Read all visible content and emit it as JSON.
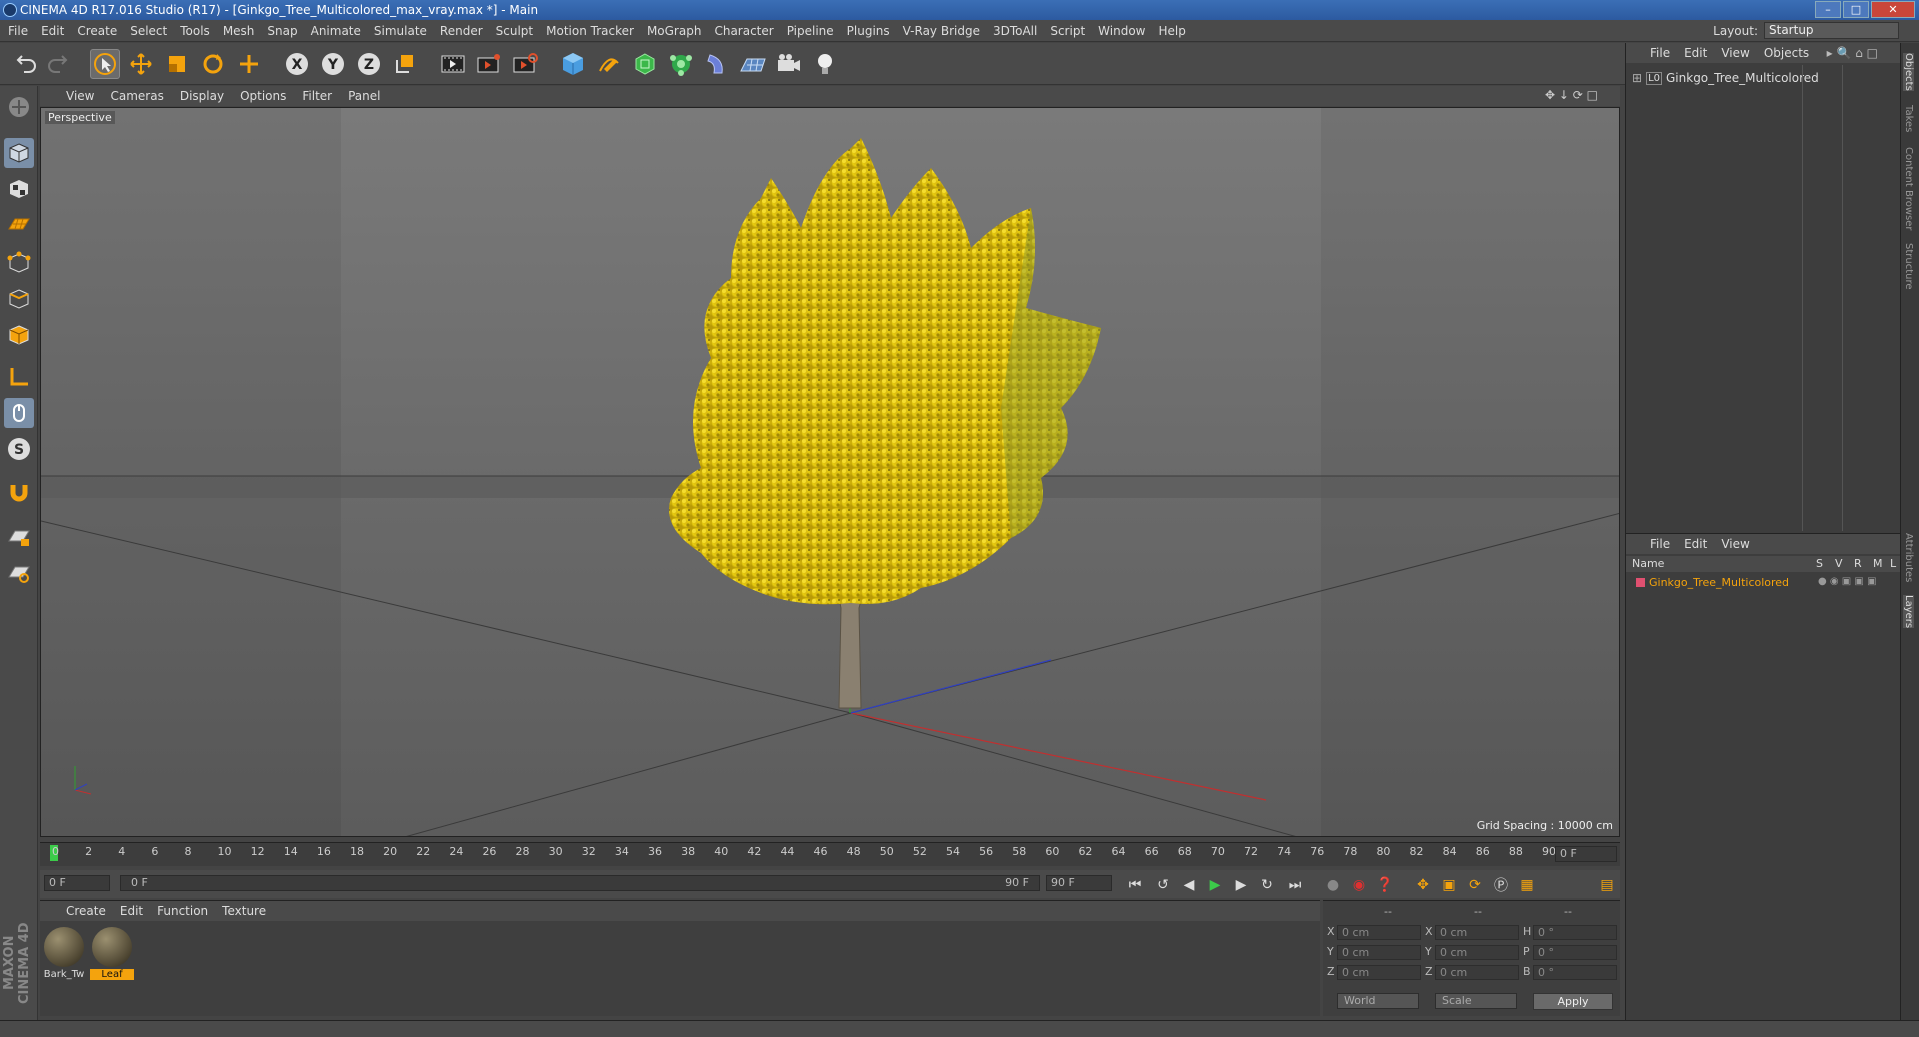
{
  "window": {
    "title": "CINEMA 4D R17.016 Studio (R17) - [Ginkgo_Tree_Multicolored_max_vray.max *] - Main"
  },
  "menubar": {
    "items": [
      "File",
      "Edit",
      "Create",
      "Select",
      "Tools",
      "Mesh",
      "Snap",
      "Animate",
      "Simulate",
      "Render",
      "Sculpt",
      "Motion Tracker",
      "MoGraph",
      "Character",
      "Pipeline",
      "Plugins",
      "V-Ray Bridge",
      "3DToAll",
      "Script",
      "Window",
      "Help"
    ]
  },
  "layout": {
    "label": "Layout:",
    "value": "Startup"
  },
  "viewport": {
    "menu": [
      "View",
      "Cameras",
      "Display",
      "Options",
      "Filter",
      "Panel"
    ],
    "camera_label": "Perspective",
    "grid_spacing": "Grid Spacing : 10000 cm"
  },
  "timeline": {
    "ticks": [
      "0",
      "2",
      "4",
      "6",
      "8",
      "10",
      "12",
      "14",
      "16",
      "18",
      "20",
      "22",
      "24",
      "26",
      "28",
      "30",
      "32",
      "34",
      "36",
      "38",
      "40",
      "42",
      "44",
      "46",
      "48",
      "50",
      "52",
      "54",
      "56",
      "58",
      "60",
      "62",
      "64",
      "66",
      "68",
      "70",
      "72",
      "74",
      "76",
      "78",
      "80",
      "82",
      "84",
      "86",
      "88",
      "90"
    ],
    "current_frame": "0 F"
  },
  "transport": {
    "start_frame": "0 F",
    "range_start": "0 F",
    "range_end": "90 F",
    "end_frame": "90 F"
  },
  "materials": {
    "menu": [
      "Create",
      "Edit",
      "Function",
      "Texture"
    ],
    "items": [
      {
        "label": "Bark_Tw"
      },
      {
        "label": "Leaf"
      }
    ]
  },
  "coordinates": {
    "header": [
      "--",
      "--",
      "--"
    ],
    "rows": [
      {
        "a": "X",
        "av": "0 cm",
        "b": "X",
        "bv": "0 cm",
        "c": "H",
        "cv": "0 °"
      },
      {
        "a": "Y",
        "av": "0 cm",
        "b": "Y",
        "bv": "0 cm",
        "c": "P",
        "cv": "0 °"
      },
      {
        "a": "Z",
        "av": "0 cm",
        "b": "Z",
        "bv": "0 cm",
        "c": "B",
        "cv": "0 °"
      }
    ],
    "mode": "World",
    "scale": "Scale",
    "apply": "Apply"
  },
  "objects_panel": {
    "menu": [
      "File",
      "Edit",
      "View",
      "Objects"
    ],
    "object_name": "Ginkgo_Tree_Multicolored"
  },
  "layers_panel": {
    "menu": [
      "File",
      "Edit",
      "View"
    ],
    "columns": {
      "name": "Name",
      "s": "S",
      "v": "V",
      "r": "R",
      "m": "M",
      "l": "L"
    },
    "layer_name": "Ginkgo_Tree_Multicolored",
    "layer_color": "#e05070"
  },
  "side_tabs": [
    "Objects",
    "Takes",
    "Content Browser",
    "Structure",
    "Attributes",
    "Layers"
  ],
  "brand": "MAXON CINEMA 4D",
  "colors": {
    "accent": "#f4a30d",
    "tree_yellow": "#e8cc10",
    "axis_x": "#c03030",
    "axis_y": "#30a030",
    "axis_z": "#3040c0"
  }
}
